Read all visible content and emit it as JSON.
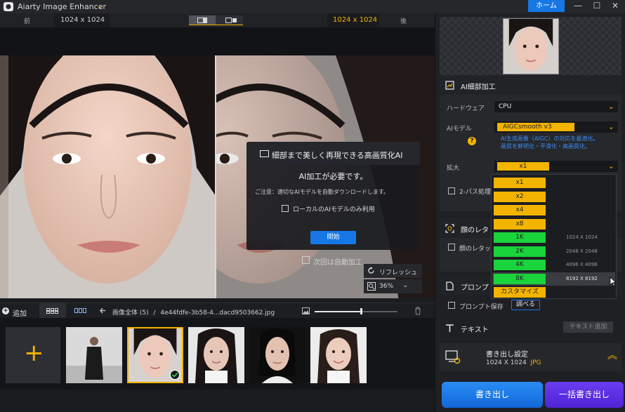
{
  "titlebar": {
    "app_title": "Aiarty Image Enhancer",
    "title_arrow": "⌄",
    "home_label": "ホーム",
    "minimize": "—",
    "maximize": "☐",
    "close": "✕"
  },
  "compare": {
    "before_label": "前",
    "after_label": "後",
    "before_resolution": "1024 x 1024",
    "after_resolution": "1024 x 1024"
  },
  "dialog": {
    "title": "細部まで美しく再現できる高画質化AI",
    "message": "AI加工が必要です。",
    "note": "ご注意：適切なAIモデルを自動ダウンロードします。",
    "local_only_label": "ローカルのAIモデルのみ利用",
    "start_label": "開始"
  },
  "preview_controls": {
    "auto_process_label": "次回は自動加工",
    "refresh_label": "リフレッシュ",
    "zoom_value": "36%",
    "zoom_arrow": "⌄"
  },
  "filmstrip": {
    "add_label": "追加",
    "breadcrumb_all": "画像全体 (5)",
    "breadcrumb_sep": "/",
    "breadcrumb_file": "4e44fdfe-3b58-4...dacd9503662.jpg",
    "zoom_slider_fraction": 0.56,
    "add_tile_plus": "+",
    "thumbnails": [
      {
        "name": "thumb-man-suit",
        "selected": false
      },
      {
        "name": "thumb-woman-1",
        "selected": true
      },
      {
        "name": "thumb-girl-1",
        "selected": false
      },
      {
        "name": "thumb-woman-2",
        "selected": false
      },
      {
        "name": "thumb-girl-2",
        "selected": false
      }
    ]
  },
  "panel": {
    "detail_section_title": "AI細部加工",
    "hardware_label": "ハードウェア",
    "hardware_value": "CPU",
    "ai_model_label": "AIモデル",
    "ai_model_value": "AIGCsmooth  v3",
    "ai_model_note_1": "AI生成画像（AIGC）の対応を最適化。",
    "ai_model_note_2": "画質を鮮明化・平滑化・高画質化。",
    "help_glyph": "?",
    "scale_label": "拡大",
    "scale_value": "x1",
    "two_pass_label": "2-パス処理",
    "face_section_title": "顔のレタ",
    "face_check_label": "顔のレタッ",
    "prompt_section_title": "プロンプ",
    "prompt_save_label": "プロンプト保存",
    "prompt_search_label": "調べる",
    "text_section_title": "テキスト",
    "text_add_label": "テキスト追加",
    "export_settings_title": "書き出し設定",
    "export_size": "1024 X 1024",
    "export_format": "JPG",
    "export_button": "書き出し",
    "batch_export_button": "一括書き出し",
    "chevron": "⌄",
    "double_chevron": "︽"
  },
  "scale_menu": {
    "items": [
      {
        "label": "x1",
        "res": "",
        "color": "#f2b400"
      },
      {
        "label": "x2",
        "res": "",
        "color": "#f2b400"
      },
      {
        "label": "x4",
        "res": "",
        "color": "#f2b400"
      },
      {
        "label": "x8",
        "res": "",
        "color": "#f2b400"
      },
      {
        "label": "1K",
        "res": "1024 X 1024",
        "color": "#19d43a"
      },
      {
        "label": "2K",
        "res": "2048 X 2048",
        "color": "#19d43a"
      },
      {
        "label": "4K",
        "res": "4096 X 4096",
        "color": "#19d43a"
      },
      {
        "label": "8K",
        "res": "8192 X 8192",
        "color": "#19d43a"
      },
      {
        "label": "カスタマイズ",
        "res": "",
        "color": "#f2b400"
      }
    ],
    "hovered_index": 7
  },
  "colors": {
    "accent": "#f2b400",
    "primary": "#1677e5",
    "batch": "#5a2ee4",
    "resolution_option": "#19d43a"
  }
}
